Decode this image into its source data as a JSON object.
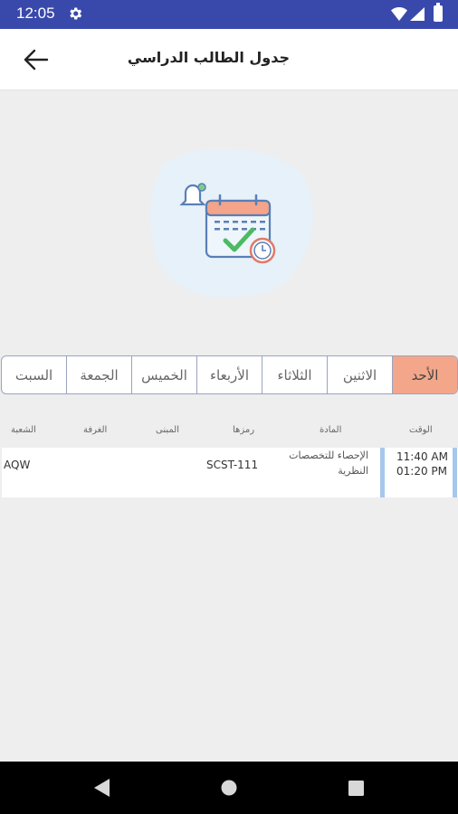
{
  "status_bar": {
    "time": "12:05",
    "icons": [
      "gear-icon",
      "wifi-icon",
      "signal-icon",
      "battery-icon"
    ],
    "color": "#3949ab"
  },
  "app_bar": {
    "title": "جدول الطالب الدراسي",
    "back_icon": "arrow-left-icon"
  },
  "illustration": {
    "icon": "calendar-check-icon"
  },
  "days": [
    {
      "label": "الأحد",
      "active": true
    },
    {
      "label": "الاثنين",
      "active": false
    },
    {
      "label": "الثلاثاء",
      "active": false
    },
    {
      "label": "الأربعاء",
      "active": false
    },
    {
      "label": "الخميس",
      "active": false
    },
    {
      "label": "الجمعة",
      "active": false
    },
    {
      "label": "السبت",
      "active": false
    }
  ],
  "table": {
    "headers": {
      "time": "الوقت",
      "subject": "المادة",
      "code": "رمزها",
      "building": "المبنى",
      "room": "الغرفة",
      "section": "الشعبة"
    },
    "rows": [
      {
        "time_start": "11:40 AM",
        "time_end": "01:20 PM",
        "subject": "الإحصاء للتخصصات النظرية",
        "code": "SCST-111",
        "building": "",
        "room": "",
        "section": "AQW"
      }
    ]
  },
  "colors": {
    "accent_active_tab": "#f3a68a",
    "time_bar": "#a7c7ec"
  },
  "nav_bar": {
    "icons": [
      "back-triangle-icon",
      "home-circle-icon",
      "recents-square-icon"
    ]
  }
}
